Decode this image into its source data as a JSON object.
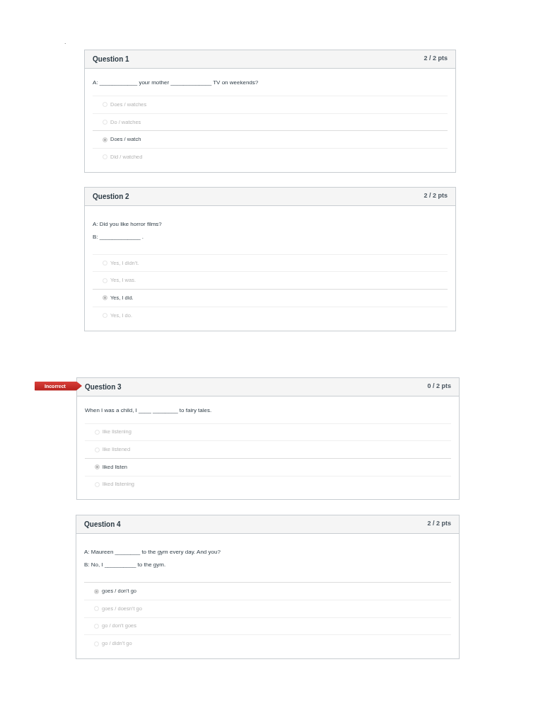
{
  "page_mark": ".",
  "questions": [
    {
      "title": "Question 1",
      "points": "2 / 2 pts",
      "prompt": [
        "A: ____________ your mother _____________ TV on weekends?"
      ],
      "answers": [
        {
          "label": "Does / watches",
          "selected": false
        },
        {
          "label": "Do / watches",
          "selected": false
        },
        {
          "label": "Does / watch",
          "selected": true
        },
        {
          "label": "Did / watched",
          "selected": false
        }
      ]
    },
    {
      "title": "Question 2",
      "points": "2 / 2 pts",
      "prompt": [
        "A: Did you like horror films?",
        "B: _____________ ."
      ],
      "answers": [
        {
          "label": "Yes, I didn't.",
          "selected": false
        },
        {
          "label": "Yes, I was.",
          "selected": false
        },
        {
          "label": "Yes, I did.",
          "selected": true
        },
        {
          "label": "Yes, I do.",
          "selected": false
        }
      ]
    },
    {
      "title": "Question 3",
      "points": "0 / 2 pts",
      "flag": "Incorrect",
      "prompt": [
        "When I was a child, I ____ ________ to fairy tales."
      ],
      "answers": [
        {
          "label": "like listening",
          "selected": false
        },
        {
          "label": "like listened",
          "selected": false
        },
        {
          "label": "liked listen",
          "selected": true
        },
        {
          "label": "liked listening",
          "selected": false
        }
      ]
    },
    {
      "title": "Question 4",
      "points": "2 / 2 pts",
      "prompt": [
        "A: Maureen ________ to the gym every day. And you?",
        "B: No, I __________ to the gym."
      ],
      "answers": [
        {
          "label": "goes / don't go",
          "selected": true
        },
        {
          "label": "goes / doesn't go",
          "selected": false
        },
        {
          "label": "go / don't goes",
          "selected": false
        },
        {
          "label": "go / didn't go",
          "selected": false
        }
      ]
    }
  ]
}
